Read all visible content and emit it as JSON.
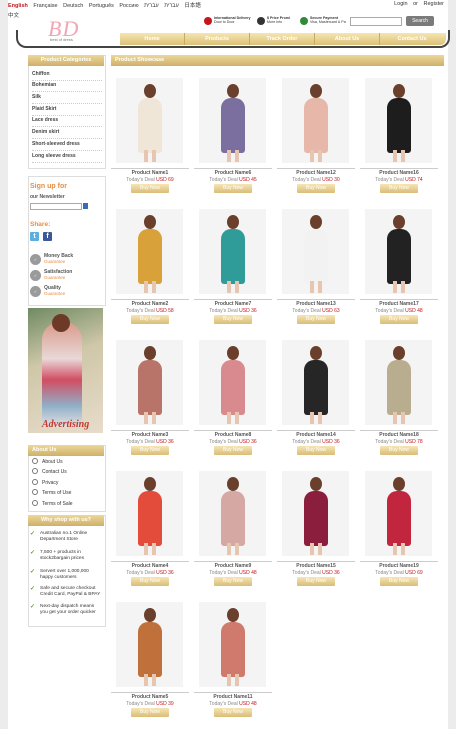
{
  "topbar": {
    "languages": [
      "English",
      "Française",
      "Deutsch",
      "Português",
      "Россию",
      "עברית",
      "עברית",
      "日本語"
    ],
    "language2": "中文",
    "login": "Login",
    "or": "or",
    "register": "Register"
  },
  "logo": {
    "text": "BD",
    "tagline": "best of dress"
  },
  "features": [
    {
      "line1": "International Delivery",
      "line2": "Door to Door",
      "color": "#c4161c"
    },
    {
      "line1": "$ Price Promi",
      "line2": "More Info",
      "color": "#333333"
    },
    {
      "line1": "Secure Payment",
      "line2": "Visa, Mastercard & Pa",
      "color": "#2e8b3a"
    }
  ],
  "search": {
    "placeholder": "",
    "button": "Search"
  },
  "nav": [
    "Home",
    "Products",
    "Track Order",
    "About Us",
    "Contact Us"
  ],
  "categories": {
    "title": "Product Categories",
    "items": [
      "Chiffon",
      "Bohemian",
      "Silk",
      "Plaid Skirt",
      "Lace dress",
      "Denim skirt",
      "Short-sleeved dress",
      "Long sleeve dress"
    ]
  },
  "newsletter": {
    "title": "Sign up for",
    "subtitle": "our Newsletter"
  },
  "share": {
    "title": "Share:",
    "icons": [
      "twitter-icon",
      "facebook-icon"
    ]
  },
  "guarantees": [
    {
      "title": "Money Back",
      "sub": "Guarantee"
    },
    {
      "title": "Satisfaction",
      "sub": "Guarantee"
    },
    {
      "title": "Quality",
      "sub": "Guarantee"
    }
  ],
  "ad": {
    "text": "Advertising"
  },
  "about": {
    "title": "About Us",
    "links": [
      "About Us",
      "Contact Us",
      "Privacy",
      "Terms of Use",
      "Terms of Sale"
    ]
  },
  "why": {
    "title": "Why shop with us?",
    "items": [
      "Australian no.1 Online Department Store",
      "7,500 + products in stock2bargain prices",
      "Servert over 1,000,000 happy customers",
      "Safe and secure checkout Credit Card, PayPal & BPAY",
      "Next-day dispatch means you get your order quicker"
    ]
  },
  "main": {
    "title": "Product Showcase",
    "deal_label": "Today's Deal",
    "buy_label": "Buy Now",
    "products": [
      {
        "name": "Product Name1",
        "price": "USD 69",
        "dress": "#efe6d8"
      },
      {
        "name": "Product Name6",
        "price": "USD 45",
        "dress": "#7b6fa0"
      },
      {
        "name": "Product Name12",
        "price": "USD 30",
        "dress": "#e7b7aa"
      },
      {
        "name": "Product Name16",
        "price": "USD 74",
        "dress": "#1d1d1d"
      },
      {
        "name": "Product Name2",
        "price": "USD 58",
        "dress": "#d9a13a"
      },
      {
        "name": "Product Name7",
        "price": "USD 36",
        "dress": "#2f9c9a"
      },
      {
        "name": "Product Name13",
        "price": "USD 63",
        "dress": "#f2f2f2"
      },
      {
        "name": "Product Name17",
        "price": "USD 48",
        "dress": "#222222"
      },
      {
        "name": "Product Name3",
        "price": "USD 36",
        "dress": "#b9746a"
      },
      {
        "name": "Product Name8",
        "price": "USD 36",
        "dress": "#d98a8f"
      },
      {
        "name": "Product Name14",
        "price": "USD 36",
        "dress": "#262626"
      },
      {
        "name": "Product Name18",
        "price": "USD 78",
        "dress": "#b9ad8f"
      },
      {
        "name": "Product Name4",
        "price": "USD 36",
        "dress": "#e34b3a"
      },
      {
        "name": "Product Name9",
        "price": "USD 48",
        "dress": "#d6a8a4"
      },
      {
        "name": "Product Name15",
        "price": "USD 36",
        "dress": "#8b1e3c"
      },
      {
        "name": "Product Name19",
        "price": "USD 69",
        "dress": "#c2263e"
      },
      {
        "name": "Product Name5",
        "price": "USD 39",
        "dress": "#c0703a"
      },
      {
        "name": "Product Name11",
        "price": "USD 48",
        "dress": "#d07a6e"
      }
    ]
  },
  "colors": {
    "accent": "#d9bd77",
    "price": "#c4161c",
    "highlight": "#e48e45"
  }
}
